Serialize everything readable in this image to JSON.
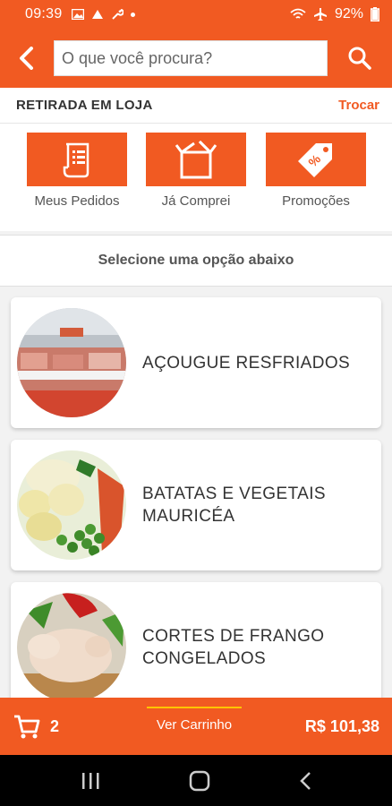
{
  "status": {
    "time": "09:39",
    "battery": "92%"
  },
  "header": {
    "search_placeholder": "O que você procura?"
  },
  "store": {
    "label": "RETIRADA EM LOJA",
    "change": "Trocar"
  },
  "actions": [
    {
      "label": "Meus Pedidos",
      "icon": "receipt-icon"
    },
    {
      "label": "Já Comprei",
      "icon": "box-icon"
    },
    {
      "label": "Promoções",
      "icon": "tag-percent-icon"
    }
  ],
  "hint": "Selecione uma opção abaixo",
  "categories": [
    {
      "line1": "AÇOUGUE RESFRIADOS",
      "line2": ""
    },
    {
      "line1": "BATATAS E VEGETAIS",
      "line2": "MAURICÉA"
    },
    {
      "line1": "CORTES DE FRANGO",
      "line2": "CONGELADOS"
    }
  ],
  "cart": {
    "count": "2",
    "view_label": "Ver Carrinho",
    "total": "R$ 101,38"
  },
  "colors": {
    "brand": "#f15a22",
    "accent": "#ffc400"
  }
}
